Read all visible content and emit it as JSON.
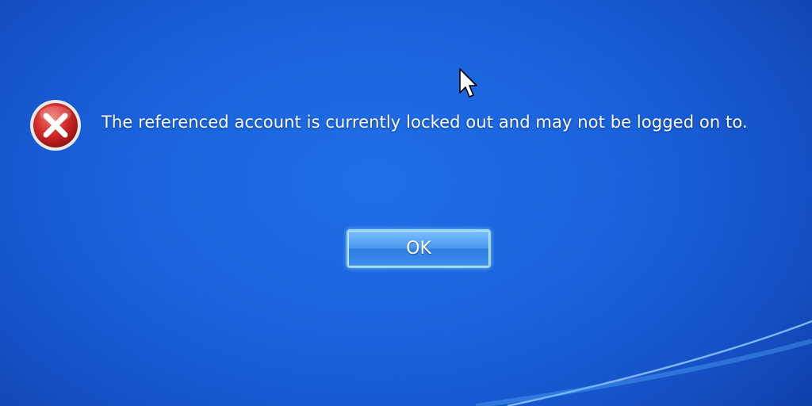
{
  "dialog": {
    "message": "The referenced account is currently locked out and may not be logged on to.",
    "ok_label": "OK",
    "icon": "error-icon"
  },
  "colors": {
    "background": "#1a62db",
    "text": "#ffffff",
    "error_red": "#d42a2a",
    "button_border": "#8fd3ff"
  }
}
